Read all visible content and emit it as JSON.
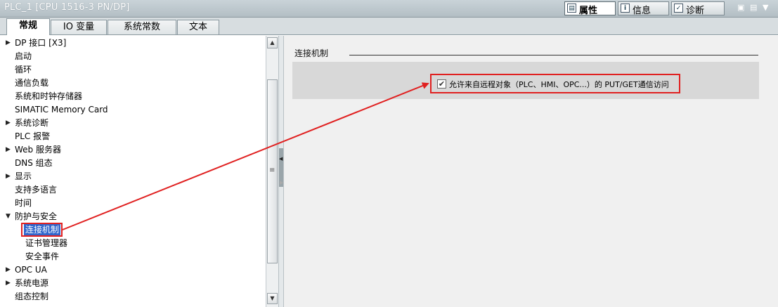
{
  "header": {
    "title": "PLC_1 [CPU 1516-3 PN/DP]",
    "panel_tabs": [
      {
        "label": "属性",
        "icon": "properties-icon",
        "active": true
      },
      {
        "label": "信息",
        "icon": "info-icon",
        "active": false
      },
      {
        "label": "诊断",
        "icon": "diagnostics-icon",
        "active": false
      }
    ]
  },
  "tabs": [
    {
      "label": "常规",
      "active": true
    },
    {
      "label": "IO 变量",
      "active": false
    },
    {
      "label": "系统常数",
      "active": false
    },
    {
      "label": "文本",
      "active": false
    }
  ],
  "nav": {
    "items": [
      {
        "label": "DP 接口 [X3]",
        "expandable": true,
        "expanded": false,
        "level": 0
      },
      {
        "label": "启动",
        "expandable": false,
        "level": 0
      },
      {
        "label": "循环",
        "expandable": false,
        "level": 0
      },
      {
        "label": "通信负载",
        "expandable": false,
        "level": 0
      },
      {
        "label": "系统和时钟存储器",
        "expandable": false,
        "level": 0
      },
      {
        "label": "SIMATIC Memory Card",
        "expandable": false,
        "level": 0
      },
      {
        "label": "系统诊断",
        "expandable": true,
        "expanded": false,
        "level": 0
      },
      {
        "label": "PLC 报警",
        "expandable": false,
        "level": 0
      },
      {
        "label": "Web 服务器",
        "expandable": true,
        "expanded": false,
        "level": 0
      },
      {
        "label": "DNS 组态",
        "expandable": false,
        "level": 0
      },
      {
        "label": "显示",
        "expandable": true,
        "expanded": false,
        "level": 0
      },
      {
        "label": "支持多语言",
        "expandable": false,
        "level": 0
      },
      {
        "label": "时间",
        "expandable": false,
        "level": 0
      },
      {
        "label": "防护与安全",
        "expandable": true,
        "expanded": true,
        "level": 0
      },
      {
        "label": "连接机制",
        "expandable": false,
        "level": 1,
        "selected": true
      },
      {
        "label": "证书管理器",
        "expandable": false,
        "level": 1
      },
      {
        "label": "安全事件",
        "expandable": false,
        "level": 1
      },
      {
        "label": "OPC UA",
        "expandable": true,
        "expanded": false,
        "level": 0
      },
      {
        "label": "系统电源",
        "expandable": true,
        "expanded": false,
        "level": 0
      },
      {
        "label": "组态控制",
        "expandable": false,
        "level": 0
      }
    ]
  },
  "content": {
    "section_title": "连接机制",
    "checkbox_label": "允许来自远程对象（PLC、HMI、OPC...）的 PUT/GET通信访问",
    "checkbox_checked": true
  },
  "colors": {
    "annotation": "#e02020",
    "selection": "#3166cc"
  }
}
